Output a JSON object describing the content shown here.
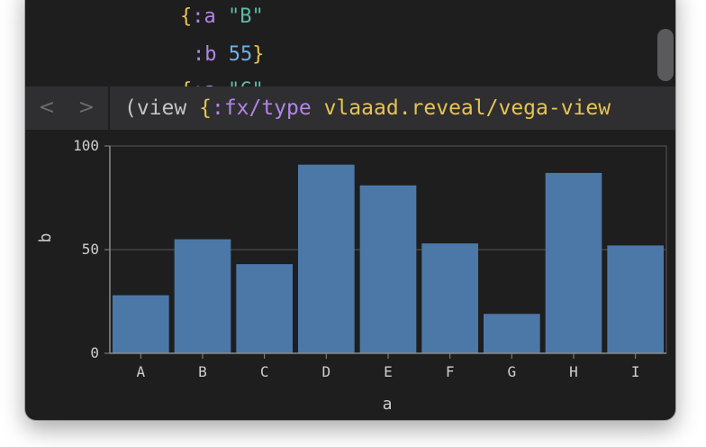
{
  "editor": {
    "lines": [
      {
        "brace_open": "{",
        "key": ":a",
        "value": "\"B\"",
        "brace_close": ""
      },
      {
        "brace_open": "",
        "key": ":b",
        "value": "55",
        "brace_close": "}"
      },
      {
        "brace_open": "{",
        "key": ":a",
        "value": "\"C\"",
        "brace_close": ""
      }
    ]
  },
  "nav": {
    "back_label": "<",
    "forward_label": ">",
    "paren": "(view",
    "brace": "{",
    "kw": ":fx/type",
    "sym": "vlaaad.reveal/vega-view"
  },
  "chart_data": {
    "type": "bar",
    "categories": [
      "A",
      "B",
      "C",
      "D",
      "E",
      "F",
      "G",
      "H",
      "I"
    ],
    "values": [
      28,
      55,
      43,
      91,
      81,
      53,
      19,
      87,
      52
    ],
    "xlabel": "a",
    "ylabel": "b",
    "ylim": [
      0,
      100
    ],
    "yticks": [
      "0",
      "50",
      "100"
    ],
    "grid": true,
    "colors": {
      "bar": "#4c78a8",
      "axis": "#8a8a8a",
      "grid": "#555555",
      "text": "#cfcfcf"
    }
  }
}
